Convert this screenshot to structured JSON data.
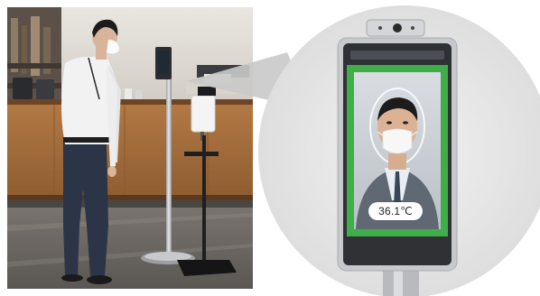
{
  "photo": {
    "scene": "lobby-reception",
    "subject": "man-in-mask-at-kiosk",
    "device": "temperature-kiosk-on-stand"
  },
  "zoom": {
    "screen": {
      "temperature": "36.1℃",
      "frame_color": "#3fae49",
      "screen_bg": "#c9d0d6"
    }
  },
  "colors": {
    "circle_bg": "#e8e8e8",
    "bezel": "#2f3135",
    "device_silver": "#c8c9cc",
    "floor": "#6e6a66",
    "counter": "#a86d3b",
    "shirt": "#f2f2f2",
    "trousers": "#2c3547"
  }
}
